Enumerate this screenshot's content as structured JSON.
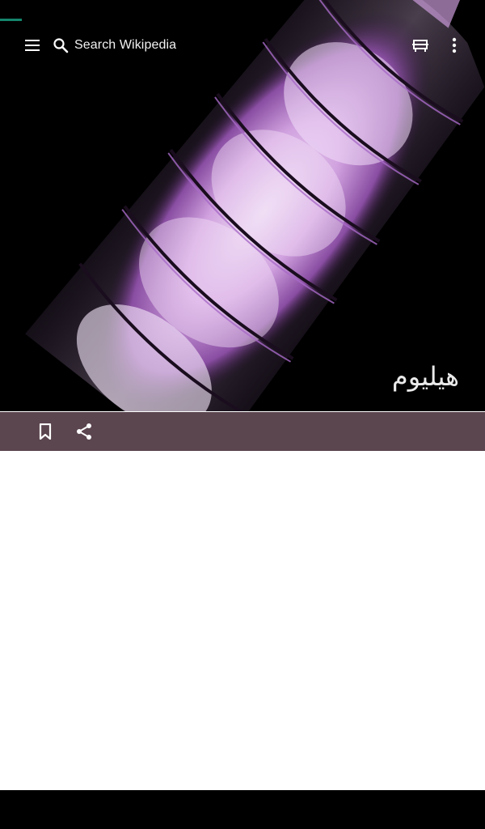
{
  "search": {
    "placeholder": "Search Wikipedia"
  },
  "article": {
    "title": "هيليوم"
  },
  "icons": {
    "menu": "menu-icon",
    "search": "search-icon",
    "reading_lists": "reading-lists-icon",
    "overflow": "more-vertical-icon",
    "bookmark": "bookmark-icon",
    "share": "share-icon"
  },
  "colors": {
    "action_bar": "#5b454f",
    "progress_accent": "#14866d",
    "content_background": "#ffffff",
    "glow": "#d9a8e8"
  }
}
